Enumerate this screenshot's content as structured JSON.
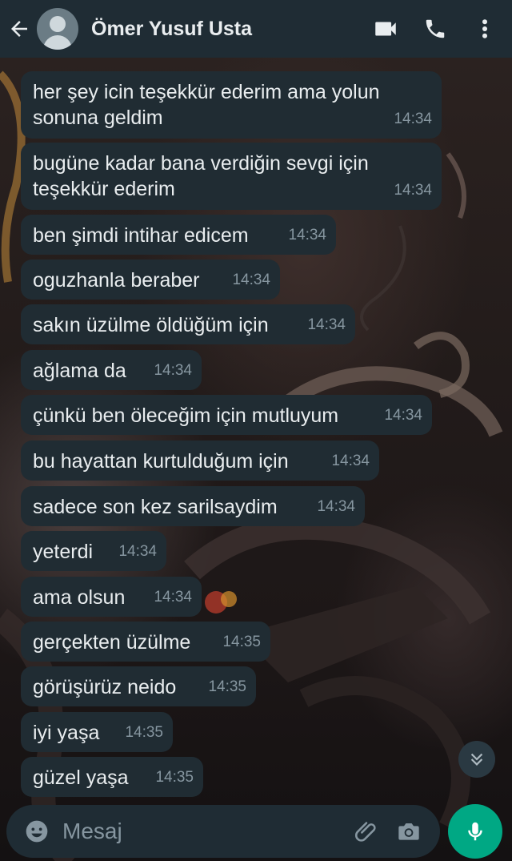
{
  "header": {
    "contact_name": "Ömer Yusuf Usta"
  },
  "icons": {
    "back": "arrow-left-icon",
    "avatar": "default-avatar",
    "video": "video-camera-icon",
    "call": "phone-icon",
    "menu": "more-vertical-icon",
    "scroll": "double-chevron-down-icon",
    "emoji": "emoji-icon",
    "attach": "paperclip-icon",
    "camera": "camera-icon",
    "mic": "microphone-icon"
  },
  "colors": {
    "header_bg": "#1f2c34",
    "bubble_bg": "#202c33",
    "text": "#e9edef",
    "meta": "#8696a0",
    "accent": "#00a884"
  },
  "messages": [
    {
      "text": "her şey icin teşekkür ederim ama yolun\nsonuna geldim",
      "time": "14:34"
    },
    {
      "text": "bugüne kadar bana verdiğin sevgi için\nteşekkür ederim",
      "time": "14:34"
    },
    {
      "text": "ben şimdi intihar edicem",
      "time": "14:34"
    },
    {
      "text": "oguzhanla beraber",
      "time": "14:34"
    },
    {
      "text": "sakın üzülme öldüğüm için",
      "time": "14:34"
    },
    {
      "text": "ağlama da",
      "time": "14:34"
    },
    {
      "text": "çünkü ben öleceğim için mutluyum",
      "time": "14:34"
    },
    {
      "text": "bu hayattan kurtulduğum için",
      "time": "14:34"
    },
    {
      "text": "sadece son kez sarilsaydim",
      "time": "14:34"
    },
    {
      "text": "yeterdi",
      "time": "14:34"
    },
    {
      "text": "ama olsun",
      "time": "14:34"
    },
    {
      "text": "gerçekten üzülme",
      "time": "14:35"
    },
    {
      "text": "görüşürüz neido",
      "time": "14:35"
    },
    {
      "text": "iyi yaşa",
      "time": "14:35"
    },
    {
      "text": "güzel yaşa",
      "time": "14:35"
    }
  ],
  "composer": {
    "placeholder": "Mesaj"
  }
}
